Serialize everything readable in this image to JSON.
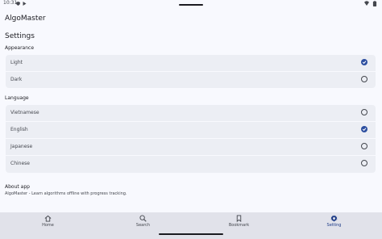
{
  "status_bar": {
    "time": "10:31"
  },
  "app": {
    "title": "AlgoMaster"
  },
  "page": {
    "title": "Settings"
  },
  "appearance": {
    "title": "Appearance",
    "options": [
      {
        "label": "Light",
        "selected": true
      },
      {
        "label": "Dark",
        "selected": false
      }
    ]
  },
  "language": {
    "title": "Language",
    "options": [
      {
        "label": "Vietnamese",
        "selected": false
      },
      {
        "label": "English",
        "selected": true
      },
      {
        "label": "Japanese",
        "selected": false
      },
      {
        "label": "Chinese",
        "selected": false
      }
    ]
  },
  "about": {
    "title": "About app",
    "description": "AlgoMaster - Learn algorithms offline with progress tracking."
  },
  "bottom_nav": {
    "items": [
      {
        "label": "Home",
        "icon": "home-icon",
        "active": false
      },
      {
        "label": "Search",
        "icon": "search-icon",
        "active": false
      },
      {
        "label": "Bookmark",
        "icon": "bookmark-icon",
        "active": false
      },
      {
        "label": "Setting",
        "icon": "gear-icon",
        "active": true
      }
    ]
  },
  "colors": {
    "accent": "#2d4fa0",
    "background": "#f8f9fe",
    "card": "#eceef4",
    "nav_background": "#e1e2ea"
  }
}
